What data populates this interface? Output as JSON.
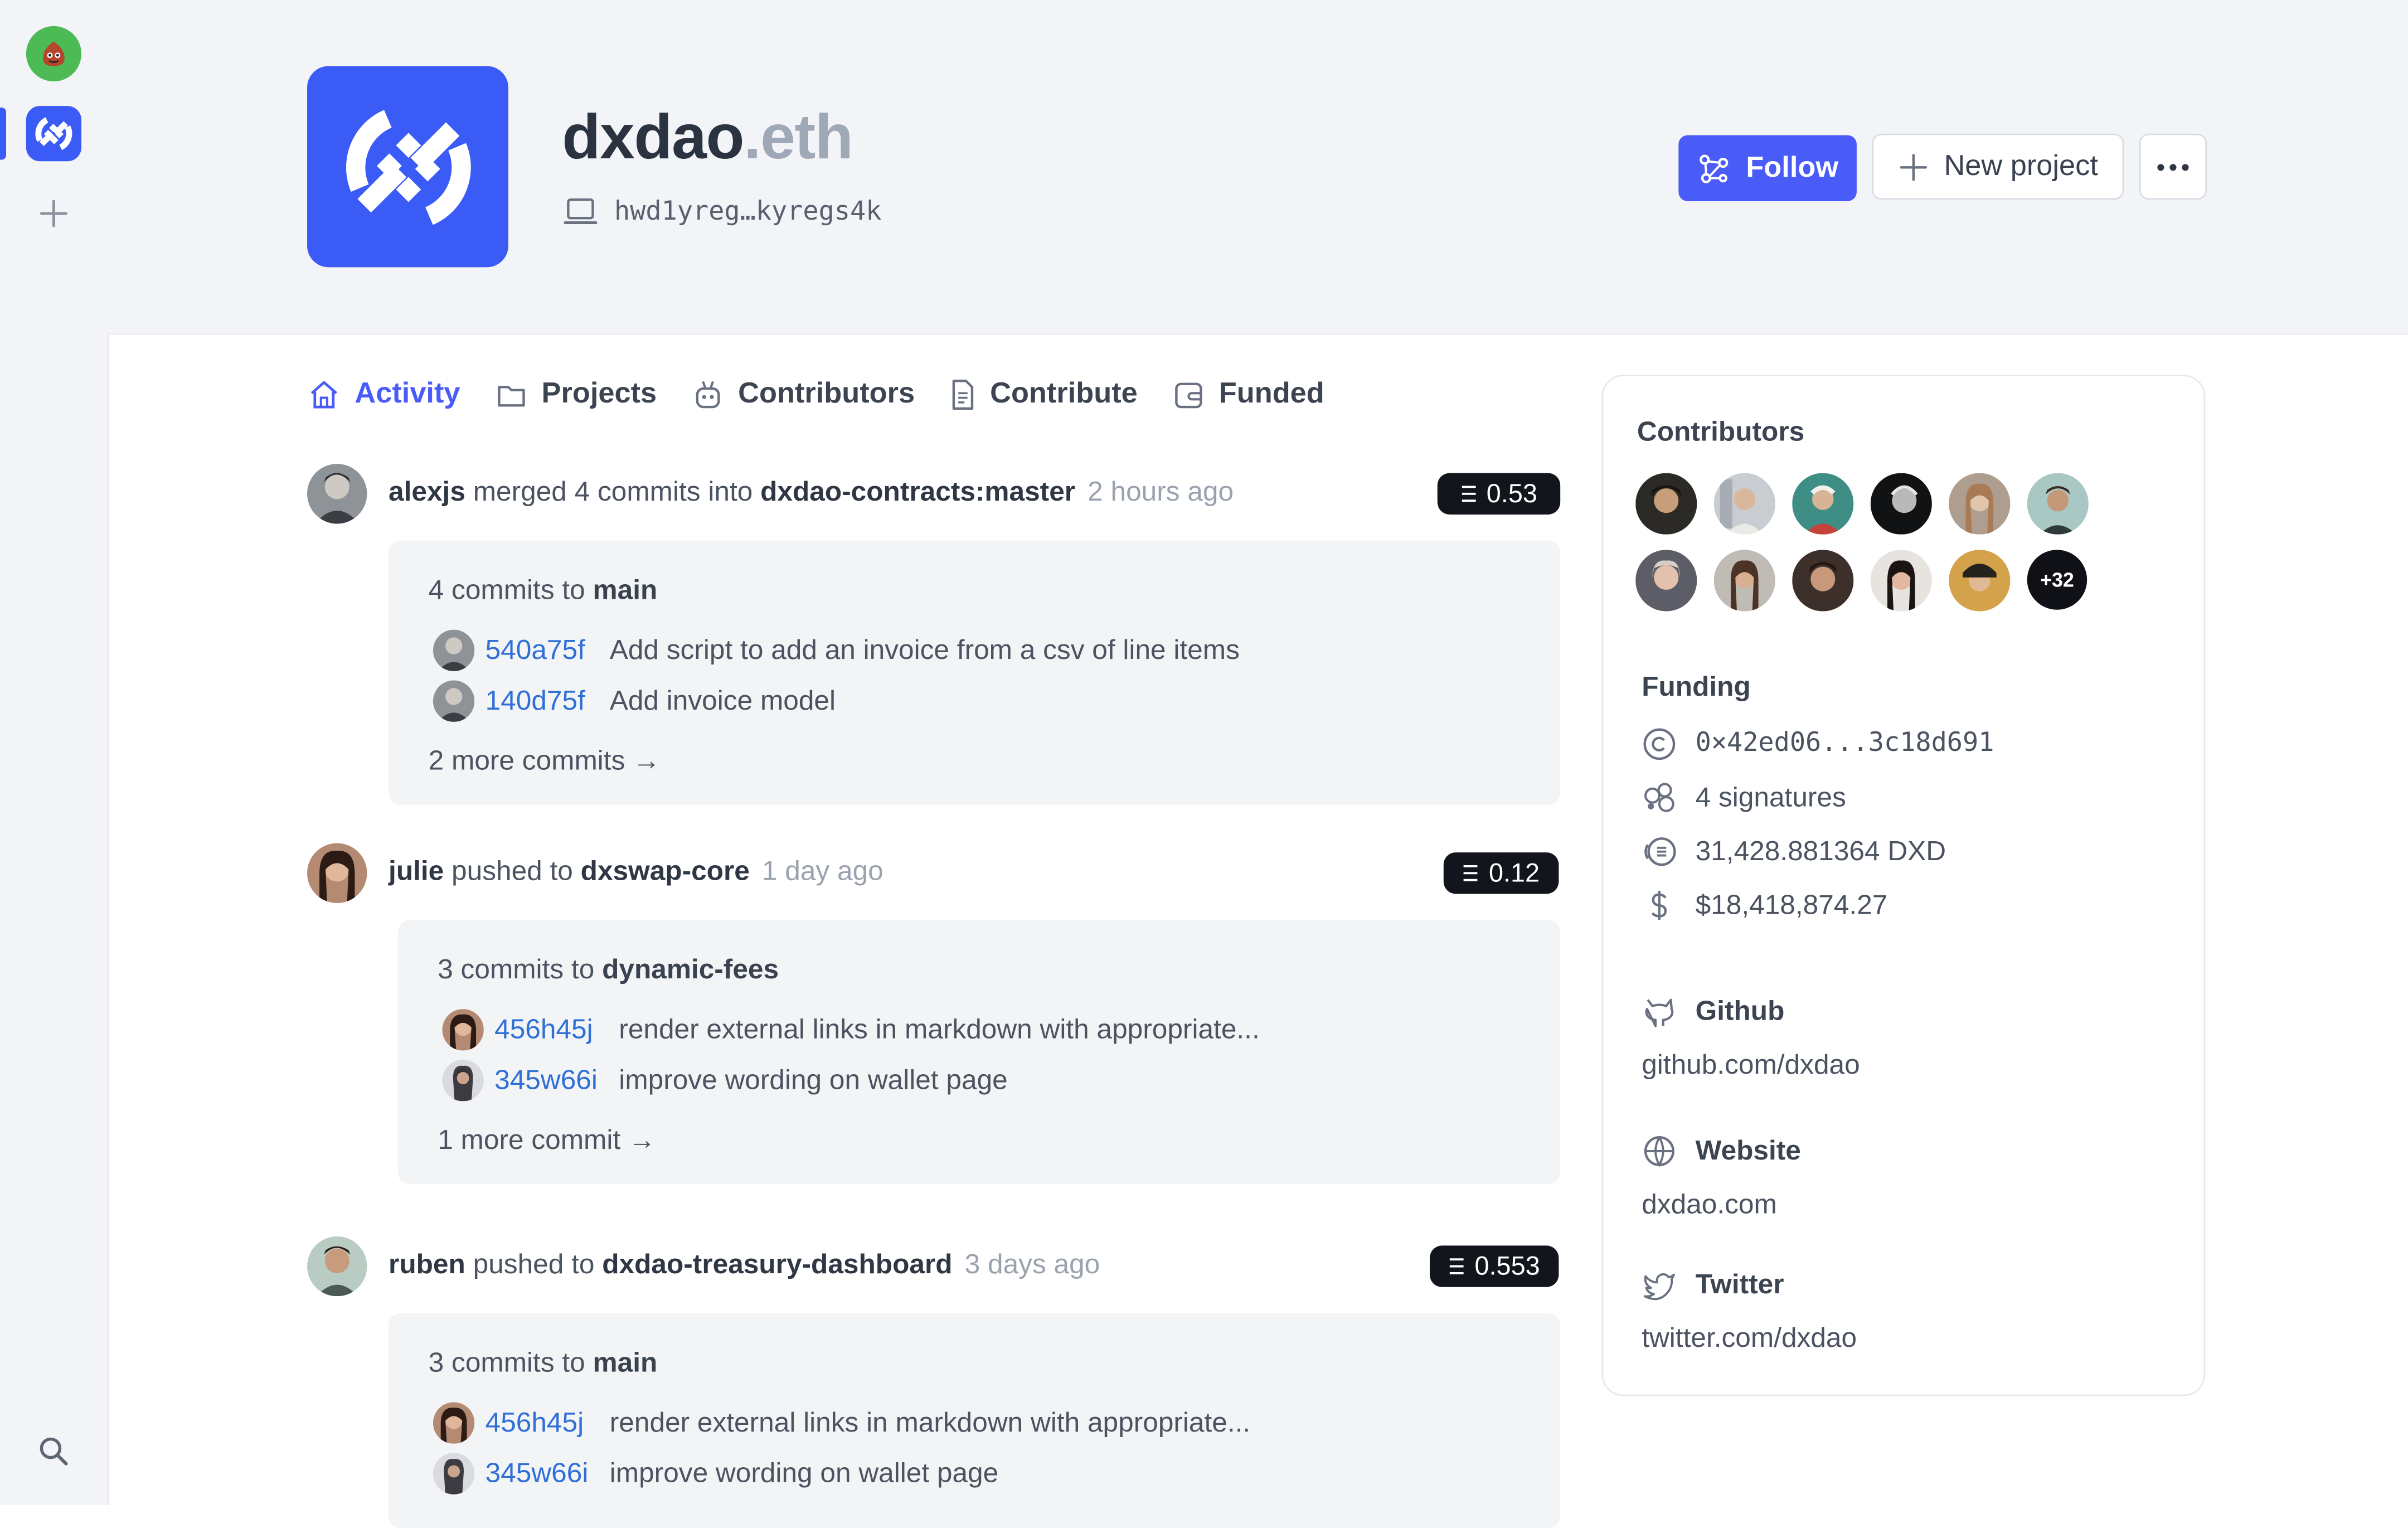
{
  "org": {
    "name": "dxdao",
    "suffix": ".eth",
    "id": "hwd1yreg…kyregs4k"
  },
  "header": {
    "follow_label": "Follow",
    "new_project_label": "New project"
  },
  "tabs": [
    {
      "label": "Activity",
      "icon": "home-icon",
      "active": true
    },
    {
      "label": "Projects",
      "icon": "folder-icon"
    },
    {
      "label": "Contributors",
      "icon": "robot-icon"
    },
    {
      "label": "Contribute",
      "icon": "document-icon"
    },
    {
      "label": "Funded",
      "icon": "wallet-icon"
    }
  ],
  "activity": [
    {
      "user": "alexjs",
      "action": " merged 4 commits into ",
      "target": "dxdao-contracts:master",
      "time": "2 hours ago",
      "amount": "0.53",
      "commits_count": "4 commits to ",
      "branch": "main",
      "commits": [
        {
          "hash": "540a75f",
          "message": "Add script to add an invoice from a csv of line items"
        },
        {
          "hash": "140d75f",
          "message": "Add invoice model"
        }
      ],
      "more": "2 more commits →"
    },
    {
      "user": "julie",
      "action": " pushed to ",
      "target": "dxswap-core",
      "time": "1 day ago",
      "amount": "0.12",
      "commits_count": "3 commits to ",
      "branch": "dynamic-fees",
      "commits": [
        {
          "hash": "456h45j",
          "message": "render external links in markdown with appropriate..."
        },
        {
          "hash": "345w66i",
          "message": "improve wording on wallet page"
        }
      ],
      "more": "1 more commit →"
    },
    {
      "user": "ruben",
      "action": " pushed to ",
      "target": "dxdao-treasury-dashboard",
      "time": "3 days ago",
      "amount": "0.553",
      "commits_count": "3 commits to ",
      "branch": "main",
      "commits": [
        {
          "hash": "456h45j",
          "message": "render external links in markdown with appropriate..."
        },
        {
          "hash": "345w66i",
          "message": "improve wording on wallet page"
        }
      ]
    }
  ],
  "sidebar": {
    "contributors_title": "Contributors",
    "contributors_more": "+32",
    "funding_title": "Funding",
    "funding": {
      "address": "0×42ed06...3c18d691",
      "signatures": "4 signatures",
      "token_balance": "31,428.881364 DXD",
      "usd_balance": "$18,418,874.27"
    },
    "links": [
      {
        "label": "Github",
        "value": "github.com/dxdao",
        "icon": "github-icon"
      },
      {
        "label": "Website",
        "value": "dxdao.com",
        "icon": "globe-icon"
      },
      {
        "label": "Twitter",
        "value": "twitter.com/dxdao",
        "icon": "twitter-icon"
      }
    ]
  },
  "colors": {
    "accent": "#4a5cf8",
    "org_logo": "#3b5bf6",
    "hash_link": "#2f6fd7",
    "amount_badge": "#12151b"
  }
}
